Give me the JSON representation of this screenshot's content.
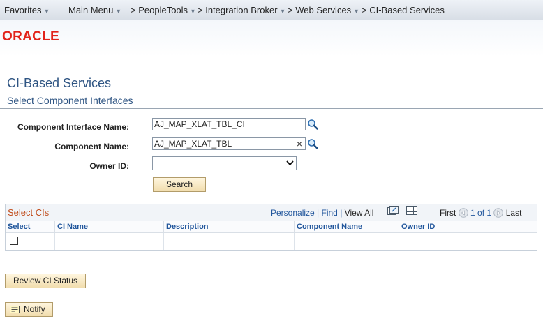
{
  "nav": {
    "favorites": "Favorites",
    "main_menu": "Main Menu",
    "peopletools": "PeopleTools",
    "integration_broker": "Integration Broker",
    "web_services": "Web Services",
    "ci_services": "CI-Based Services",
    "dropdown_arrow": "▼",
    "crumb_sep": ">"
  },
  "brand": {
    "logo": "ORACLE",
    "color": "#e2231a"
  },
  "page": {
    "title": "CI-Based Services",
    "subtitle": "Select Component Interfaces"
  },
  "form": {
    "ci_name_label": "Component Interface Name:",
    "ci_name_value": "AJ_MAP_XLAT_TBL_CI",
    "component_label": "Component Name:",
    "component_value": "AJ_MAP_XLAT_TBL",
    "owner_label": "Owner ID:",
    "owner_value": "",
    "search_button": "Search",
    "clear_icon": "×"
  },
  "grid": {
    "title": "Select CIs",
    "personalize": "Personalize",
    "find": "Find",
    "view_all": "View All",
    "sep": "|",
    "first": "First",
    "range": "1 of 1",
    "last": "Last",
    "columns": [
      "Select",
      "CI Name",
      "Description",
      "Component Name",
      "Owner ID"
    ]
  },
  "buttons": {
    "review": "Review CI Status",
    "notify": "Notify"
  },
  "colors": {
    "title_blue": "#2f5583",
    "link_blue": "#21569c",
    "grid_title": "#c14d1c"
  }
}
